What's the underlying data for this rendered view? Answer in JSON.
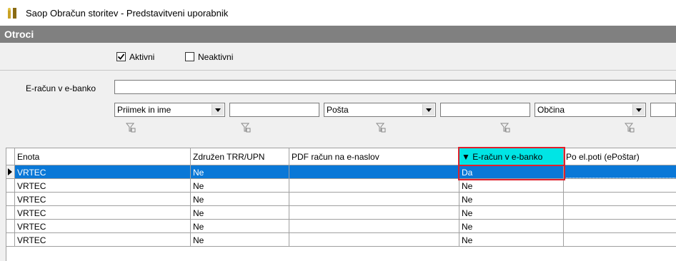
{
  "window": {
    "title": "Saop Obračun storitev - Predstavitveni uporabnik"
  },
  "section": {
    "title": "Otroci"
  },
  "filters": {
    "aktivni_label": "Aktivni",
    "aktivni_checked": true,
    "neaktivni_label": "Neaktivni",
    "neaktivni_checked": false,
    "eracun_label": "E-račun v e-banko",
    "eracun_value": "",
    "combos": [
      {
        "selected": "Priimek in ime",
        "text": ""
      },
      {
        "selected": "Pošta",
        "text": ""
      },
      {
        "selected": "Občina",
        "text": ""
      }
    ]
  },
  "grid": {
    "columns": [
      "Enota",
      "Združen TRR/UPN",
      "PDF račun na e-naslov",
      "▼ E-račun v e-banko",
      "Po el.poti (ePoštar)"
    ],
    "rows": [
      [
        "VRTEC",
        "Ne",
        "",
        "Da",
        ""
      ],
      [
        "VRTEC",
        "Ne",
        "",
        "Ne",
        ""
      ],
      [
        "VRTEC",
        "Ne",
        "",
        "Ne",
        ""
      ],
      [
        "VRTEC",
        "Ne",
        "",
        "Ne",
        ""
      ],
      [
        "VRTEC",
        "Ne",
        "",
        "Ne",
        ""
      ],
      [
        "VRTEC",
        "Ne",
        "",
        "Ne",
        ""
      ]
    ],
    "selected_row": 0,
    "sorted_column": 3
  },
  "colors": {
    "selection": "#0a78d7",
    "sorted_header": "#00e5e5",
    "highlight": "#e0202c",
    "section_bar": "#808080"
  }
}
